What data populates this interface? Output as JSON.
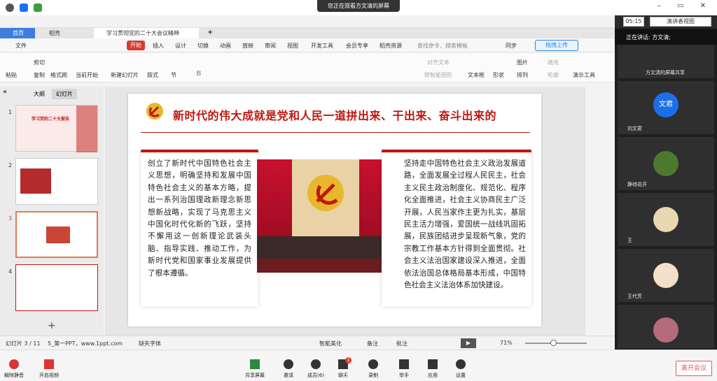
{
  "viewer_banner": "您正在观看方文清的屏幕",
  "top": {
    "timer": "05:15",
    "presenter_view": "演讲者视图"
  },
  "tabs": {
    "home": "首页",
    "wps": "稻壳",
    "doc": "学习贯彻党的二十大会议精神"
  },
  "menu": {
    "file": "文件",
    "start": "开始",
    "insert": "插入",
    "design": "设计",
    "transition": "切换",
    "animation": "动画",
    "slideshow": "放映",
    "review": "审阅",
    "view": "视图",
    "dev": "开发工具",
    "member": "会员专享",
    "resources": "稻壳资源",
    "search": "查找命令、搜索模板",
    "sync": "同步",
    "upload": "拖拽上传"
  },
  "ribbon": {
    "paste": "粘贴",
    "cut": "剪切",
    "copy": "复制",
    "format": "格式刷",
    "from_current": "当前开始",
    "new_slide": "新建幻灯片",
    "layout": "版式",
    "section": "节",
    "align": "对齐文本",
    "smartart": "转智能图形",
    "textbox": "文本框",
    "shape": "形状",
    "picture": "图片",
    "arrange": "排列",
    "fill": "填充",
    "outline": "轮廓",
    "slideshow_tool": "演示工具"
  },
  "left": {
    "outline_tab": "大纲",
    "slides_tab": "幻灯片",
    "thumbs": [
      {
        "n": "1",
        "title": "学习党的二十大报告"
      },
      {
        "n": "2"
      },
      {
        "n": "3"
      },
      {
        "n": "4"
      }
    ]
  },
  "slide": {
    "title": "新时代的伟大成就是党和人民一道拼出来、干出来、奋斗出来的",
    "left_text": "创立了新时代中国特色社会主义思想，明确坚持和发展中国特色社会主义的基本方略，提出一系列治国理政新理念新思想新战略，实现了马克思主义中国化时代化新的飞跃，坚持不懈用这一创新理论武装头脑、指导实践、推动工作，为新时代党和国家事业发展提供了根本遵循。",
    "right_text": "坚持走中国特色社会主义政治发展道路，全面发展全过程人民民主，社会主义民主政治制度化、规范化、程序化全面推进，社会主义协商民主广泛开展，人民当家作主更为扎实，基层民主活力增强，爱国统一战线巩固拓展，民族团结进步呈现新气象，党的宗教工作基本方针得到全面贯彻。社会主义法治国家建设深入推进，全面依法治国总体格局基本形成，中国特色社会主义法治体系加快建设。"
  },
  "status": {
    "slide_num": "幻灯片 3 / 11",
    "theme": "5_第一PPT，www.1ppt.com",
    "missing_font": "缺失字体",
    "beautify": "智能美化",
    "notes": "备注",
    "comment": "批注",
    "zoom": "71%"
  },
  "right": {
    "speaking": "正在讲话: 方文清;",
    "share_label": "方文清的屏幕共享",
    "participants": [
      {
        "name": "刘文君",
        "avatar": "文君",
        "color": "#1c6fe8"
      },
      {
        "name": "静待花开"
      },
      {
        "name": "王"
      },
      {
        "name": "王代芳"
      },
      {
        "name": ""
      }
    ]
  },
  "meeting": {
    "mute": "解除静音",
    "video": "开启视频",
    "share": "共享屏幕",
    "invite": "邀请",
    "members": "成员(6)",
    "chat": "聊天",
    "record": "录制",
    "raise": "举手",
    "apps": "应用",
    "settings": "设置",
    "leave": "离开会议",
    "chat_badge": "1"
  }
}
